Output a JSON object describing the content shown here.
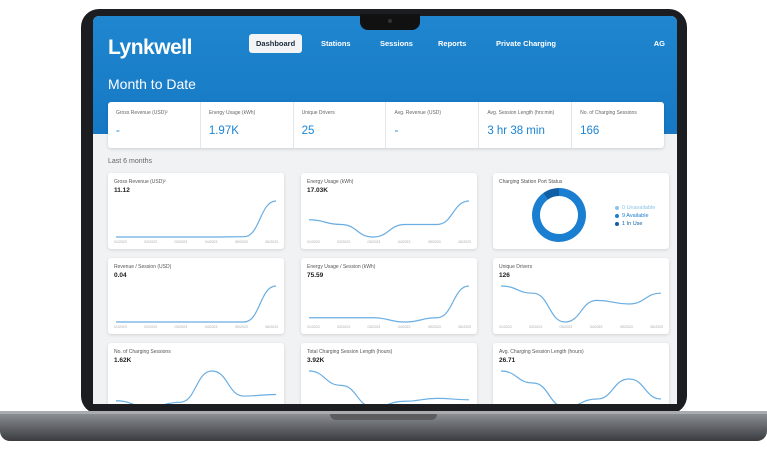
{
  "nav": {
    "logo": "Lynkwell",
    "items": [
      "Dashboard",
      "Stations",
      "Sessions",
      "Reports",
      "Private Charging"
    ],
    "active": "Dashboard",
    "user": "AG"
  },
  "header": {
    "title": "Month to Date"
  },
  "summary": [
    {
      "label": "Gross Revenue (USD)²",
      "value": "-"
    },
    {
      "label": "Energy Usage (kWh)",
      "value": "1.97K"
    },
    {
      "label": "Unique Drivers",
      "value": "25"
    },
    {
      "label": "Avg. Revenue (USD)",
      "value": "-"
    },
    {
      "label": "Avg. Session Length (hrs:min)",
      "value": "3 hr 38 min"
    },
    {
      "label": "No. of Charging Sessions",
      "value": "166"
    }
  ],
  "period_label": "Last 6 months",
  "cards": [
    {
      "title": "Gross Revenue (USD)²",
      "value": "11.12"
    },
    {
      "title": "Energy Usage (kWh)",
      "value": "17.03K"
    },
    {
      "title": "Charging Station Port Status",
      "value": ""
    },
    {
      "title": "Revenue / Session (USD)",
      "value": "0.04"
    },
    {
      "title": "Energy Usage / Session (kWh)",
      "value": "75.59"
    },
    {
      "title": "Unique Drivers",
      "value": "126"
    },
    {
      "title": "No. of Charging Sessions",
      "value": "1.62K"
    },
    {
      "title": "Total Charging Session Length (hours)",
      "value": "3.92K"
    },
    {
      "title": "Avg. Charging Session Length (hours)",
      "value": "26.71"
    }
  ],
  "tick_labels": [
    "01/2023",
    "02/2023",
    "03/2023",
    "04/2023",
    "05/2023",
    "06/2023"
  ],
  "port_status": {
    "legend": [
      {
        "label": "0  Unavailable",
        "color": "#8ec3ea",
        "value": 0
      },
      {
        "label": "9  Available",
        "color": "#1a7fd0",
        "value": 9
      },
      {
        "label": "1  In Use",
        "color": "#0f5fa6",
        "value": 1
      }
    ]
  },
  "colors": {
    "brand": "#1a80cc",
    "accent": "#1c84d4",
    "line": "#6aaee3"
  },
  "chart_data": [
    {
      "type": "line",
      "title": "Gross Revenue (USD)²",
      "x": [
        "01/2023",
        "02/2023",
        "03/2023",
        "04/2023",
        "05/2023",
        "06/2023"
      ],
      "values": [
        0,
        0,
        0,
        0,
        0.1,
        11.12
      ]
    },
    {
      "type": "line",
      "title": "Energy Usage (kWh)",
      "x": [
        "01/2023",
        "02/2023",
        "03/2023",
        "04/2023",
        "05/2023",
        "06/2023"
      ],
      "values": [
        2400,
        2100,
        1300,
        2100,
        2100,
        3600
      ]
    },
    {
      "type": "pie",
      "title": "Charging Station Port Status",
      "categories": [
        "Unavailable",
        "Available",
        "In Use"
      ],
      "values": [
        0,
        9,
        1
      ]
    },
    {
      "type": "line",
      "title": "Revenue / Session (USD)",
      "x": [
        "01/2023",
        "02/2023",
        "03/2023",
        "04/2023",
        "05/2023",
        "06/2023"
      ],
      "values": [
        0,
        0,
        0,
        0,
        0,
        0.04
      ]
    },
    {
      "type": "line",
      "title": "Energy Usage / Session (kWh)",
      "x": [
        "01/2023",
        "02/2023",
        "03/2023",
        "04/2023",
        "05/2023",
        "06/2023"
      ],
      "values": [
        70,
        70,
        70,
        68,
        70,
        85
      ]
    },
    {
      "type": "line",
      "title": "Unique Drivers",
      "x": [
        "01/2023",
        "02/2023",
        "03/2023",
        "04/2023",
        "05/2023",
        "06/2023"
      ],
      "values": [
        24,
        22,
        14,
        20,
        19,
        22
      ]
    },
    {
      "type": "line",
      "title": "No. of Charging Sessions",
      "x": [
        "01/2023",
        "02/2023",
        "03/2023",
        "04/2023",
        "05/2023",
        "06/2023"
      ],
      "values": [
        160,
        120,
        150,
        350,
        190,
        200
      ]
    },
    {
      "type": "line",
      "title": "Total Charging Session Length (hours)",
      "x": [
        "01/2023",
        "02/2023",
        "03/2023",
        "04/2023",
        "05/2023",
        "06/2023"
      ],
      "values": [
        900,
        700,
        400,
        480,
        520,
        500
      ]
    },
    {
      "type": "line",
      "title": "Avg. Charging Session Length (hours)",
      "x": [
        "01/2023",
        "02/2023",
        "03/2023",
        "04/2023",
        "05/2023",
        "06/2023"
      ],
      "values": [
        5.5,
        5.2,
        4.6,
        4.8,
        5.3,
        4.8
      ]
    }
  ]
}
